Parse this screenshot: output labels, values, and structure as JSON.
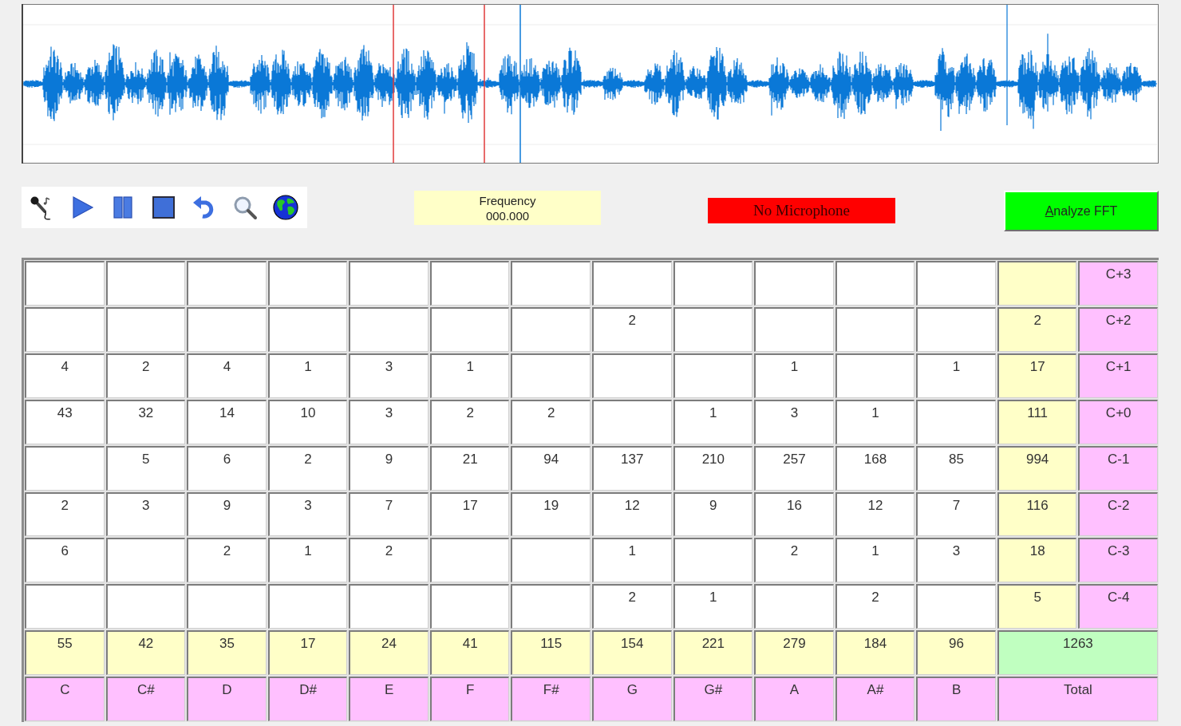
{
  "frequency": {
    "label": "Frequency",
    "value": "000.000"
  },
  "microphone_status": {
    "text": "No Microphone",
    "connected": false
  },
  "analyze_button": {
    "label": "Analyze FFT",
    "mnemonic_underlined": true
  },
  "note_table": {
    "rows": [
      {
        "octave": "C+3"
      },
      {
        "octave": "C+2",
        "counts": {
          "7": "2"
        },
        "total": "2"
      },
      {
        "octave": "C+1",
        "counts": {
          "0": "4",
          "1": "2",
          "2": "4",
          "3": "1",
          "4": "3",
          "5": "1",
          "9": "1",
          "11": "1"
        },
        "total": "17"
      },
      {
        "octave": "C+0",
        "counts": {
          "0": "43",
          "1": "32",
          "2": "14",
          "3": "10",
          "4": "3",
          "5": "2",
          "6": "2",
          "8": "1",
          "9": "3",
          "10": "1"
        },
        "total": "111"
      },
      {
        "octave": "C-1",
        "counts": {
          "1": "5",
          "2": "6",
          "3": "2",
          "4": "9",
          "5": "21",
          "6": "94",
          "7": "137",
          "8": "210",
          "9": "257",
          "10": "168",
          "11": "85"
        },
        "total": "994"
      },
      {
        "octave": "C-2",
        "counts": {
          "0": "2",
          "1": "3",
          "2": "9",
          "3": "3",
          "4": "7",
          "5": "17",
          "6": "19",
          "7": "12",
          "8": "9",
          "9": "16",
          "10": "12",
          "11": "7"
        },
        "total": "116"
      },
      {
        "octave": "C-3",
        "counts": {
          "0": "6",
          "2": "2",
          "3": "1",
          "4": "2",
          "7": "1",
          "9": "2",
          "10": "1",
          "11": "3"
        },
        "total": "18"
      },
      {
        "octave": "C-4",
        "counts": {
          "7": "2",
          "8": "1",
          "10": "2"
        },
        "total": "5"
      }
    ],
    "column_totals": [
      "55",
      "42",
      "35",
      "17",
      "24",
      "41",
      "115",
      "154",
      "221",
      "279",
      "184",
      "96"
    ],
    "grand_total": "1263",
    "notes": [
      "C",
      "C#",
      "D",
      "D#",
      "E",
      "F",
      "F#",
      "G",
      "G#",
      "A",
      "A#",
      "B"
    ],
    "total_label": "Total"
  }
}
